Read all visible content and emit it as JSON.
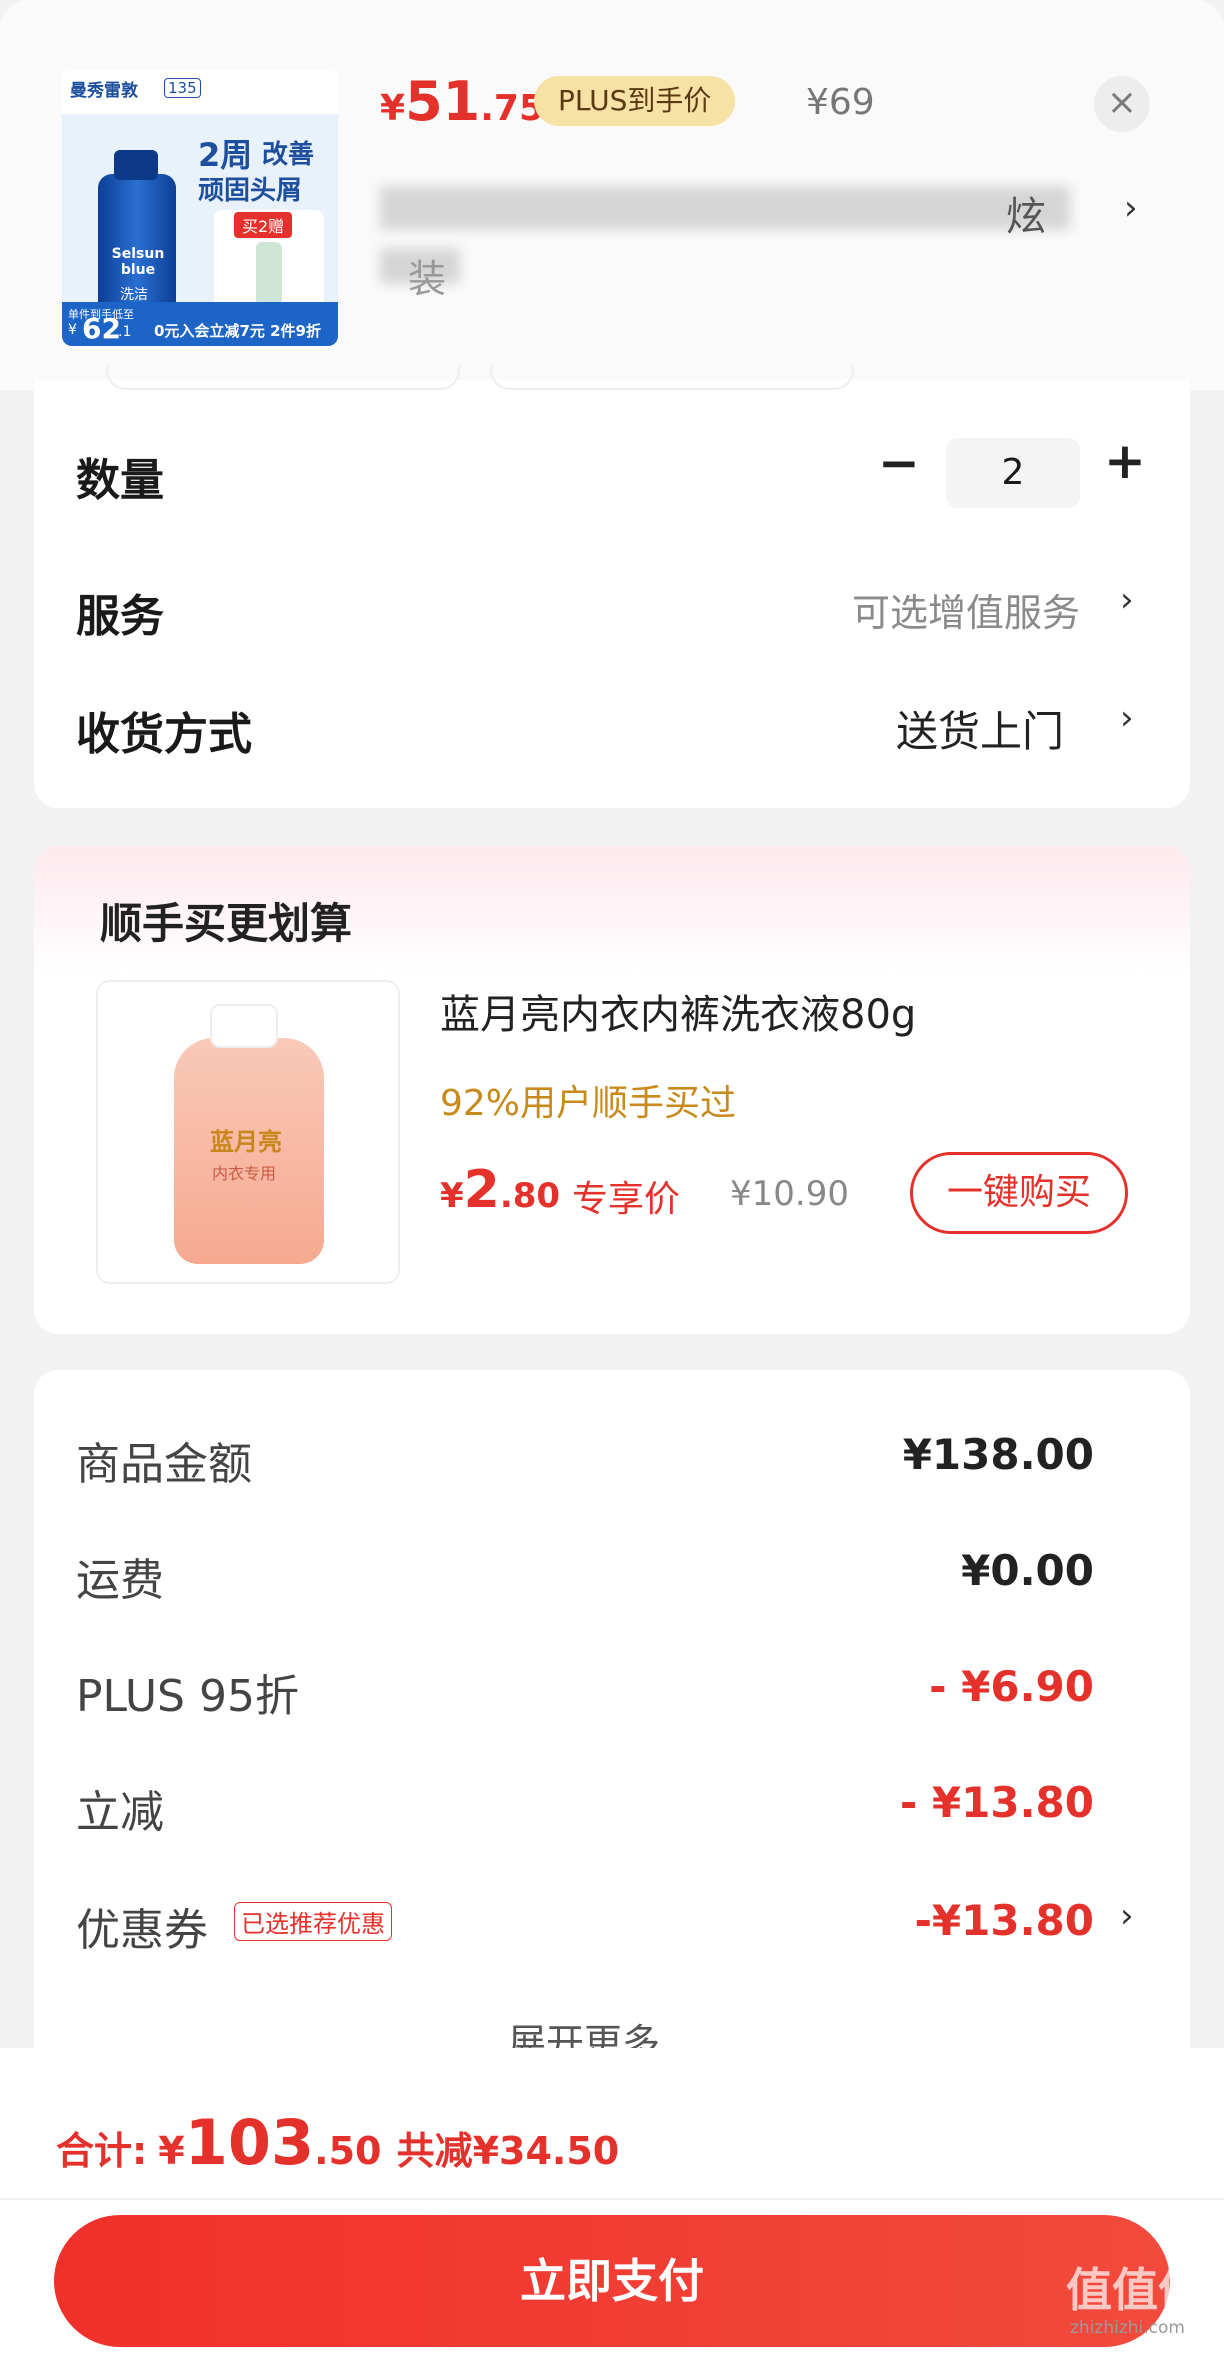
{
  "header": {
    "thumb": {
      "brand": "曼秀雷敦",
      "badge": "135",
      "tagline1": "2周",
      "tagline1b": "改善",
      "tagline2": "顽固头屑",
      "bottle_brand": "Selsun blue",
      "bottle_sub": "洗洁",
      "gift": "买2赠",
      "single_label": "单件到手低至",
      "single_price_symbol": "¥",
      "single_price_int": "62",
      "single_price_dec": ".1",
      "promo": "0元入会立减7元 2件9折"
    },
    "price_symbol": "¥",
    "price_int": "51",
    "price_dec": ".75",
    "plus_label": "PLUS到手价",
    "original_price": "¥69",
    "title_fragment": "炫",
    "title_fragment2": "装"
  },
  "options": {
    "quantity_label": "数量",
    "quantity_value": "2",
    "minus": "−",
    "plus": "+",
    "service_label": "服务",
    "service_value": "可选增值服务",
    "delivery_label": "收货方式",
    "delivery_value": "送货上门"
  },
  "addon": {
    "section_title": "顺手买更划算",
    "product_name": "蓝月亮内衣内裤洗衣液80g",
    "bottle_brand": "蓝月亮",
    "bottle_sub": "内衣专用",
    "social_proof": "92%用户顺手买过",
    "price_symbol": "¥",
    "price_int": "2",
    "price_dec": ".80",
    "price_tag": "专享价",
    "original_price": "¥10.90",
    "buy_button": "一键购买"
  },
  "summary": {
    "rows": [
      {
        "label": "商品金额",
        "value": "¥138.00"
      },
      {
        "label": "运费",
        "value": "¥0.00"
      },
      {
        "label": "PLUS 95折",
        "value": "- ¥6.90"
      },
      {
        "label": "立减",
        "value": "- ¥13.80"
      },
      {
        "label": "优惠券",
        "value": "-¥13.80",
        "tag": "已选推荐优惠"
      }
    ],
    "expand": "展开更多"
  },
  "footer": {
    "total_label": "合计:",
    "total_symbol": "¥",
    "total_int": "103",
    "total_dec": ".50",
    "saved": "共减¥34.50",
    "pay_button": "立即支付",
    "watermark": "值值值",
    "watermark_sub": "zhizhizhi.com"
  },
  "colors": {
    "accent": "#e4312b",
    "gold": "#c98a1c",
    "plus_pill": "#f7e2a6"
  }
}
